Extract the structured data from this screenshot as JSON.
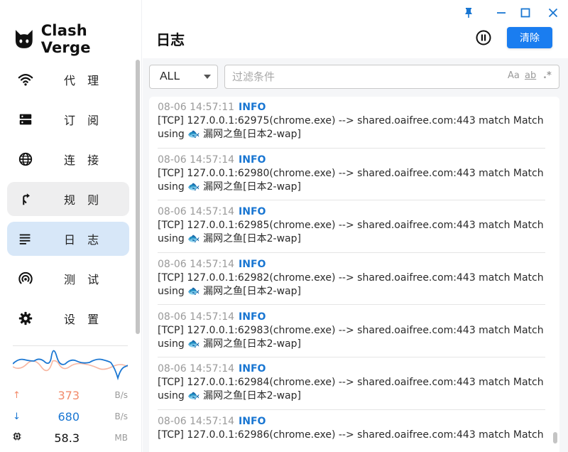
{
  "app": {
    "name": "Clash Verge"
  },
  "window": {
    "controls": [
      "pin",
      "minimize",
      "maximize",
      "close"
    ]
  },
  "sidebar": {
    "items": [
      {
        "label": "代 理",
        "icon": "wifi-icon",
        "state": "normal"
      },
      {
        "label": "订 阅",
        "icon": "dns-icon",
        "state": "normal"
      },
      {
        "label": "连 接",
        "icon": "globe-icon",
        "state": "normal"
      },
      {
        "label": "规 则",
        "icon": "fork-arrow-icon",
        "state": "hover"
      },
      {
        "label": "日 志",
        "icon": "log-lines-icon",
        "state": "active"
      },
      {
        "label": "测 试",
        "icon": "radar-icon",
        "state": "normal"
      },
      {
        "label": "设 置",
        "icon": "gear-icon",
        "state": "normal"
      }
    ],
    "traffic": {
      "upload": {
        "value": "373",
        "unit": "B/s",
        "icon": "↑",
        "color": "#f28b6b"
      },
      "download": {
        "value": "680",
        "unit": "B/s",
        "icon": "↓",
        "color": "#1976d2"
      },
      "memory": {
        "value": "58.3",
        "unit": "MB"
      }
    }
  },
  "header": {
    "title": "日志",
    "clear_label": "清除"
  },
  "filters": {
    "level": "ALL",
    "placeholder": "过滤条件",
    "match_case": "Aa",
    "whole_word": "ab",
    "regex": ".*"
  },
  "logs": [
    {
      "time": "08-06 14:57:11",
      "level": "INFO",
      "line1": "[TCP] 127.0.0.1:62975(chrome.exe) --> shared.oaifree.com:443 match Match",
      "line2": "using 🐟 漏网之鱼[日本2-wap]"
    },
    {
      "time": "08-06 14:57:14",
      "level": "INFO",
      "line1": "[TCP] 127.0.0.1:62980(chrome.exe) --> shared.oaifree.com:443 match Match",
      "line2": "using 🐟 漏网之鱼[日本2-wap]"
    },
    {
      "time": "08-06 14:57:14",
      "level": "INFO",
      "line1": "[TCP] 127.0.0.1:62985(chrome.exe) --> shared.oaifree.com:443 match Match",
      "line2": "using 🐟 漏网之鱼[日本2-wap]"
    },
    {
      "time": "08-06 14:57:14",
      "level": "INFO",
      "line1": "[TCP] 127.0.0.1:62982(chrome.exe) --> shared.oaifree.com:443 match Match",
      "line2": "using 🐟 漏网之鱼[日本2-wap]"
    },
    {
      "time": "08-06 14:57:14",
      "level": "INFO",
      "line1": "[TCP] 127.0.0.1:62983(chrome.exe) --> shared.oaifree.com:443 match Match",
      "line2": "using 🐟 漏网之鱼[日本2-wap]"
    },
    {
      "time": "08-06 14:57:14",
      "level": "INFO",
      "line1": "[TCP] 127.0.0.1:62984(chrome.exe) --> shared.oaifree.com:443 match Match",
      "line2": "using 🐟 漏网之鱼[日本2-wap]"
    },
    {
      "time": "08-06 14:57:14",
      "level": "INFO",
      "line1": "[TCP] 127.0.0.1:62986(chrome.exe) --> shared.oaifree.com:443 match Match",
      "line2": ""
    }
  ],
  "colors": {
    "accent": "#1976d2",
    "button": "#1a7df0",
    "active_nav": "#d7e7f8",
    "hover_nav": "#eeeeef"
  }
}
